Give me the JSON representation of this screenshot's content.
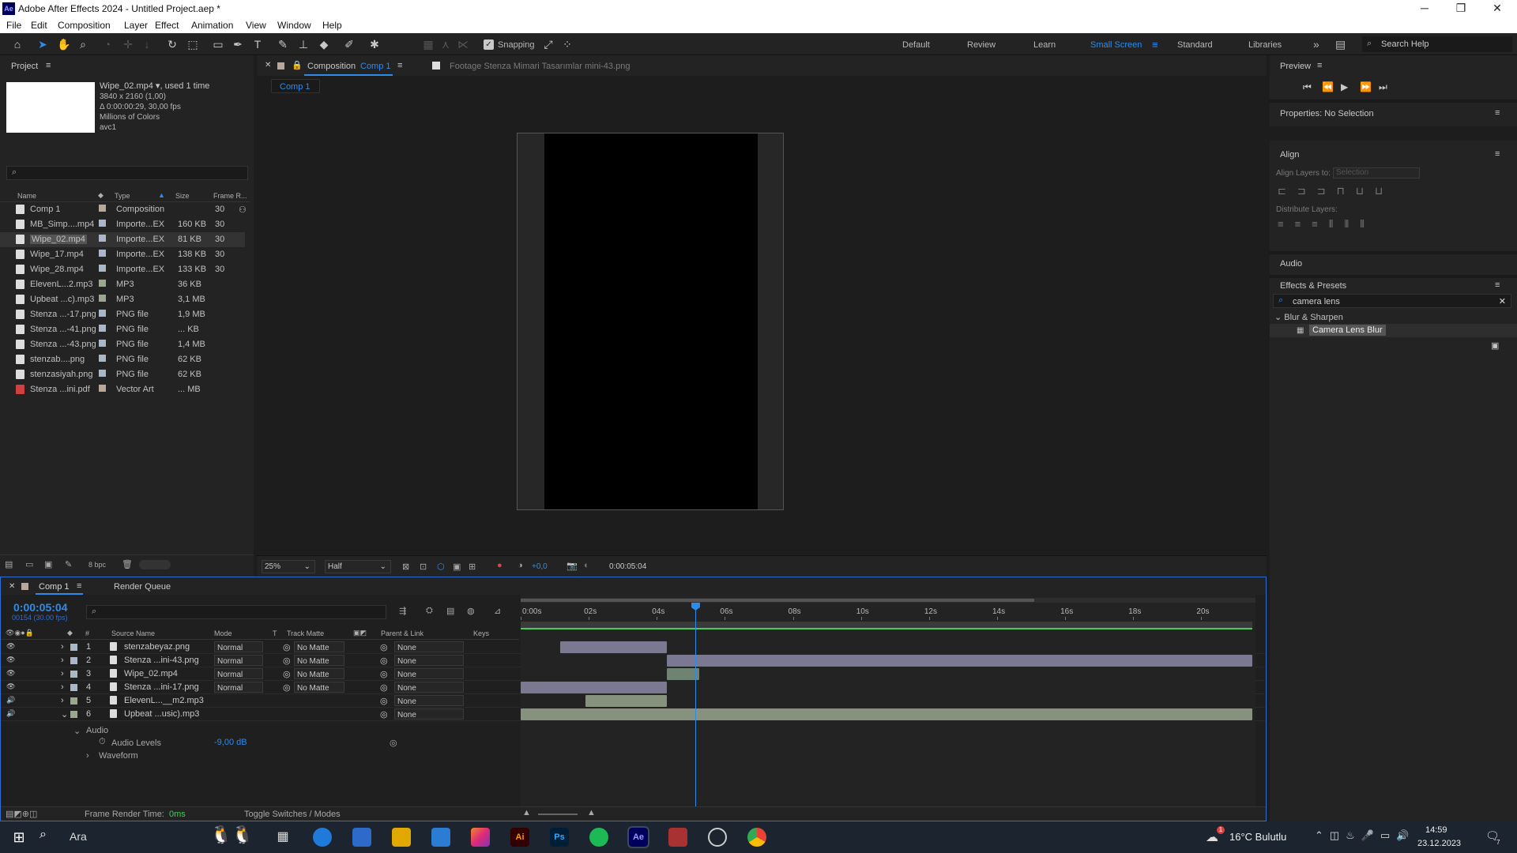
{
  "window": {
    "title": "Adobe After Effects 2024 - Untitled Project.aep *",
    "logo": "Ae",
    "minimize": "─",
    "maximize": "❐",
    "close": "✕"
  },
  "menu": [
    "File",
    "Edit",
    "Composition",
    "Layer",
    "Effect",
    "Animation",
    "View",
    "Window",
    "Help"
  ],
  "toolbar": {
    "snapping": "Snapping",
    "workspaces": [
      "Default",
      "Review",
      "Learn",
      "Small Screen",
      "Standard",
      "Libraries"
    ],
    "active_workspace": "Small Screen",
    "search_help": "Search Help",
    "more": "»"
  },
  "project": {
    "title": "Project",
    "selected_name": "Wipe_02.mp4 ▾",
    "used": ", used 1 time",
    "info": [
      "3840 x 2160 (1,00)",
      "Δ 0:00:00:29, 30,00 fps",
      "Millions of Colors",
      "avc1"
    ],
    "columns": {
      "name": "Name",
      "type": "Type",
      "size": "Size",
      "fps": "Frame R..."
    },
    "items": [
      {
        "name": "Comp 1",
        "type": "Composition",
        "size": "",
        "fps": "30"
      },
      {
        "name": "MB_Simp....mp4",
        "type": "Importe...EX",
        "size": "160 KB",
        "fps": "30"
      },
      {
        "name": "Wipe_02.mp4",
        "type": "Importe...EX",
        "size": "81 KB",
        "fps": "30"
      },
      {
        "name": "Wipe_17.mp4",
        "type": "Importe...EX",
        "size": "138 KB",
        "fps": "30"
      },
      {
        "name": "Wipe_28.mp4",
        "type": "Importe...EX",
        "size": "133 KB",
        "fps": "30"
      },
      {
        "name": "ElevenL...2.mp3",
        "type": "MP3",
        "size": "36 KB",
        "fps": ""
      },
      {
        "name": "Upbeat ...c).mp3",
        "type": "MP3",
        "size": "3,1 MB",
        "fps": ""
      },
      {
        "name": "Stenza ...-17.png",
        "type": "PNG file",
        "size": "1,9 MB",
        "fps": ""
      },
      {
        "name": "Stenza ...-41.png",
        "type": "PNG file",
        "size": "... KB",
        "fps": ""
      },
      {
        "name": "Stenza ...-43.png",
        "type": "PNG file",
        "size": "1,4 MB",
        "fps": ""
      },
      {
        "name": "stenzab....png",
        "type": "PNG file",
        "size": "62 KB",
        "fps": ""
      },
      {
        "name": "stenzasiyah.png",
        "type": "PNG file",
        "size": "62 KB",
        "fps": ""
      },
      {
        "name": "Stenza ...ini.pdf",
        "type": "Vector Art",
        "size": "... MB",
        "fps": ""
      }
    ],
    "bpc": "8 bpc"
  },
  "composition": {
    "tab_label": "Composition",
    "tab_comp": "Comp 1",
    "footage_tab": "Footage  Stenza Mimari Tasarımlar mini-43.png",
    "sub_tab": "Comp 1",
    "zoom": "25%",
    "resolution": "Half",
    "exposure": "+0,0",
    "timecode": "0:00:05:04"
  },
  "preview": {
    "title": "Preview"
  },
  "properties": {
    "title": "Properties: No Selection"
  },
  "align": {
    "title": "Align",
    "align_to_label": "Align Layers to:",
    "align_to_value": "Selection",
    "distribute": "Distribute Layers:"
  },
  "audio": {
    "title": "Audio"
  },
  "effects": {
    "title": "Effects & Presets",
    "search": "camera lens",
    "category": "Blur & Sharpen",
    "result": "Camera Lens Blur"
  },
  "timeline": {
    "tab": "Comp 1",
    "render_queue": "Render Queue",
    "timecode": "0:00:05:04",
    "frames": "00154 (30.00 fps)",
    "columns": {
      "num": "#",
      "source": "Source Name",
      "mode": "Mode",
      "t": "T",
      "track": "Track Matte",
      "parent": "Parent & Link",
      "keys": "Keys"
    },
    "ruler": [
      "0:00s",
      "02s",
      "04s",
      "06s",
      "08s",
      "10s",
      "12s",
      "14s",
      "16s",
      "18s",
      "20s"
    ],
    "layers": [
      {
        "num": "1",
        "name": "stenzabeyaz.png",
        "mode": "Normal",
        "matte": "No Matte",
        "parent": "None",
        "bar_start": 1.15,
        "bar_end": 4.3,
        "color": "#7b7891"
      },
      {
        "num": "2",
        "name": "Stenza ...ini-43.png",
        "mode": "Normal",
        "matte": "No Matte",
        "parent": "None",
        "bar_start": 4.3,
        "bar_end": 21.5,
        "color": "#7b7891"
      },
      {
        "num": "3",
        "name": "Wipe_02.mp4",
        "mode": "Normal",
        "matte": "No Matte",
        "parent": "None",
        "bar_start": 4.3,
        "bar_end": 5.25,
        "color": "#6f8372"
      },
      {
        "num": "4",
        "name": "Stenza ...ini-17.png",
        "mode": "Normal",
        "matte": "No Matte",
        "parent": "None",
        "bar_start": 0,
        "bar_end": 4.3,
        "color": "#7b7891"
      },
      {
        "num": "5",
        "name": "ElevenL...__m2.mp3",
        "mode": "",
        "matte": "",
        "parent": "None",
        "bar_start": 1.9,
        "bar_end": 4.3,
        "color": "#86917e"
      },
      {
        "num": "6",
        "name": "Upbeat ...usic).mp3",
        "mode": "",
        "matte": "",
        "parent": "None",
        "bar_start": 0,
        "bar_end": 21.5,
        "color": "#86917e"
      }
    ],
    "audio_group": "Audio",
    "audio_levels_label": "Audio Levels",
    "audio_levels_value": "-9,00 dB",
    "waveform": "Waveform",
    "frame_render": "Frame Render Time:",
    "frame_render_value": "0ms",
    "toggle": "Toggle Switches / Modes",
    "playhead_sec": 5.13
  },
  "taskbar": {
    "search": "Ara",
    "weather": "16°C  Bulutlu",
    "time": "14:59",
    "date": "23.12.2023",
    "notif": "7",
    "weather_badge": "1"
  }
}
